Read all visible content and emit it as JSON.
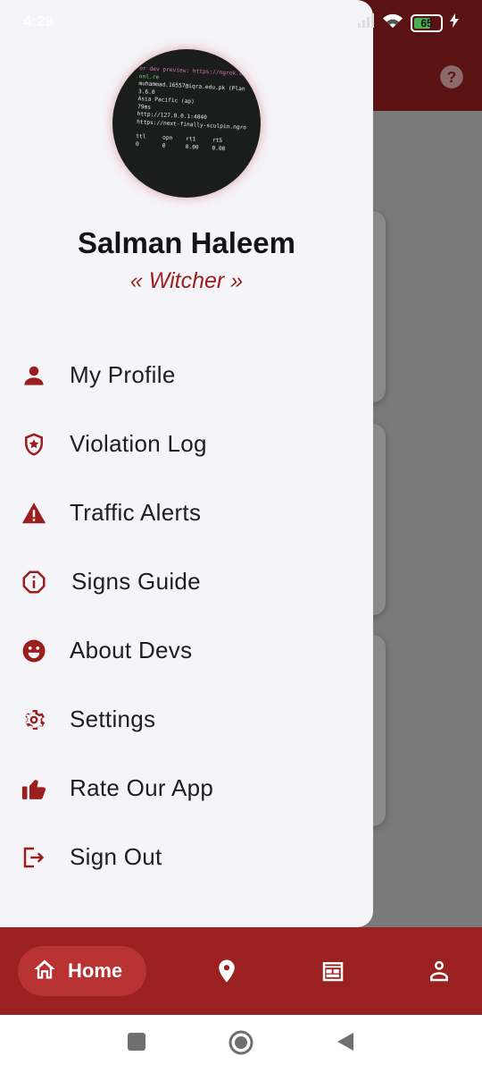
{
  "status_bar": {
    "time": "4:29",
    "battery_level": "65"
  },
  "drawer": {
    "user": {
      "name": "Salman Haleem",
      "tag": "« Witcher »",
      "avatar_terminal_lines": [
        "or dev preview: https://ngrok.com",
        "onl.re",
        "muhammad.16557@iqra.edu.pk (Plan",
        "3.6.0",
        "Asia Pacific (ap)",
        "79ms",
        "http://127.0.0.1:4040",
        "https://next-finally-sculpin.ngro",
        "ttl     opn    rt1     rt5",
        "0       0      0.00    0.00"
      ]
    },
    "menu": [
      {
        "label": "My Profile",
        "icon": "person-icon"
      },
      {
        "label": "Violation Log",
        "icon": "shield-star-icon"
      },
      {
        "label": "Traffic Alerts",
        "icon": "warning-icon"
      },
      {
        "label": "Signs Guide",
        "icon": "info-octagon-icon"
      },
      {
        "label": "About Devs",
        "icon": "smiley-icon"
      },
      {
        "label": "Settings",
        "icon": "gear-icon"
      },
      {
        "label": "Rate Our App",
        "icon": "thumbs-up-icon"
      },
      {
        "label": "Sign Out",
        "icon": "sign-out-icon"
      }
    ]
  },
  "bottom_nav": {
    "home_label": "Home",
    "items": [
      "home-icon",
      "location-pin-icon",
      "calendar-icon",
      "user-icon"
    ]
  },
  "colors": {
    "accent": "#9b1e1e",
    "nav_background": "#9b2020",
    "active_pill": "#b83232",
    "drawer_background": "#f5f4f9"
  }
}
